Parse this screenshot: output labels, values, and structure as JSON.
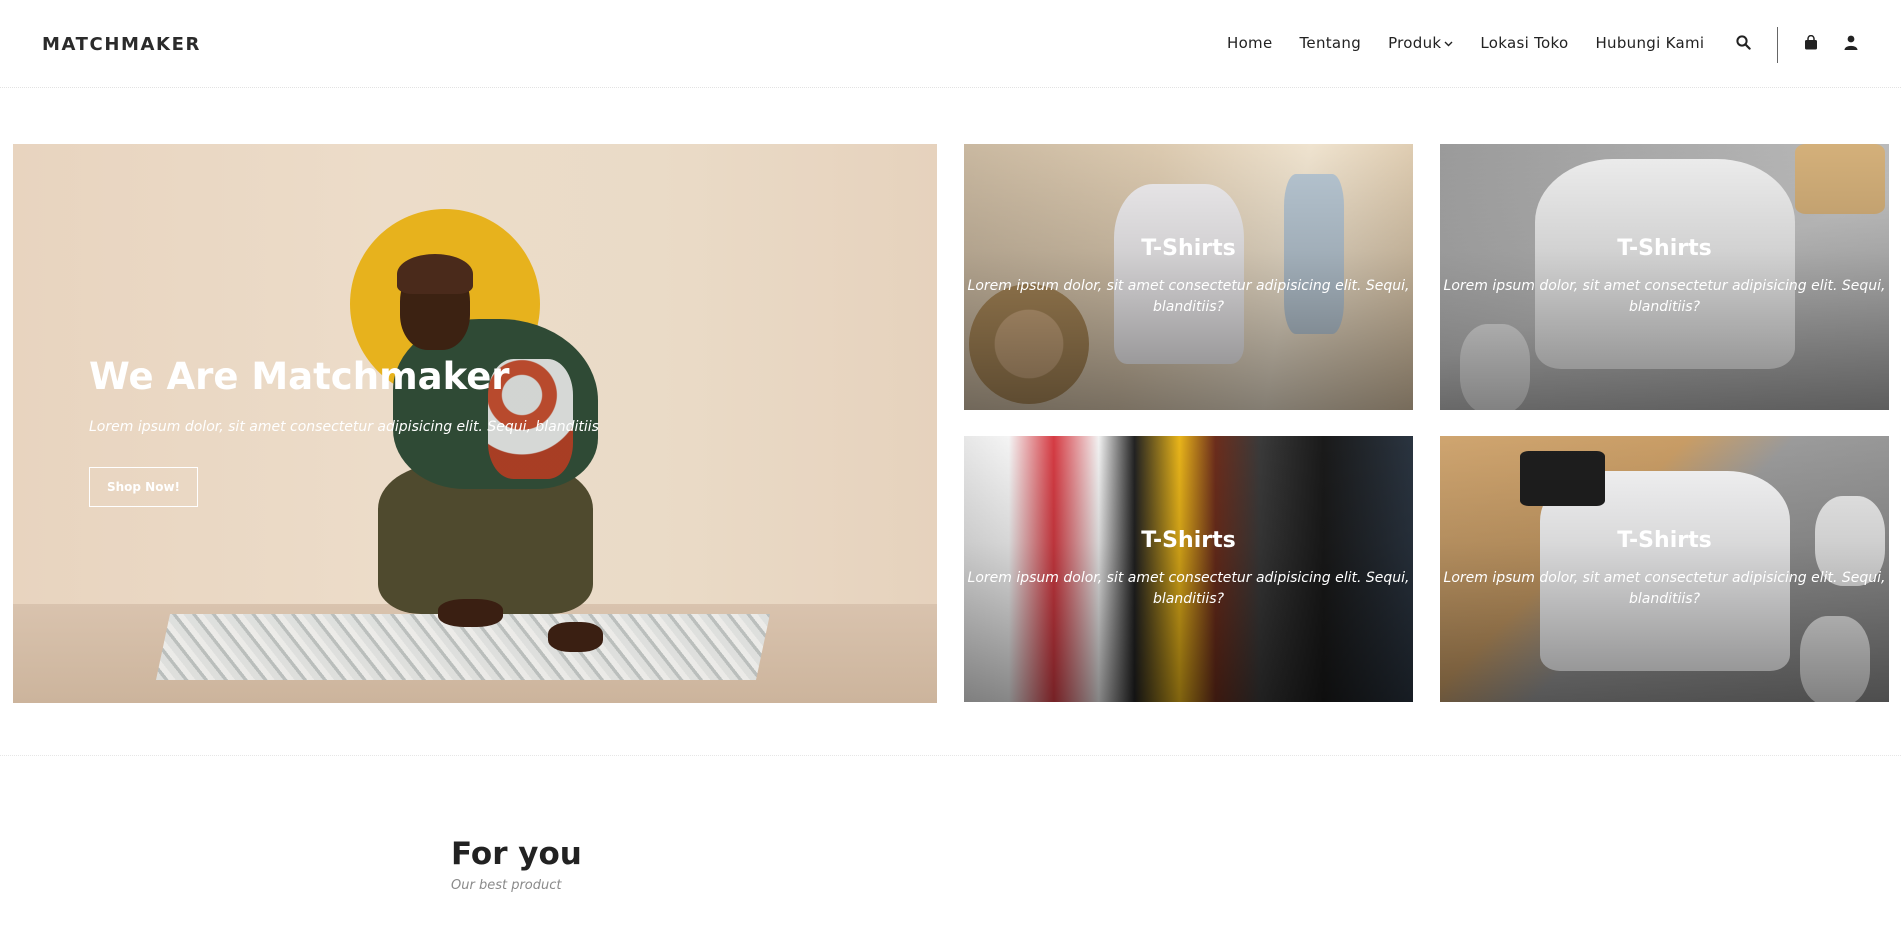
{
  "header": {
    "brand": "MATCHMAKER",
    "nav": {
      "home": "Home",
      "about": "Tentang",
      "products": "Produk",
      "store_location": "Lokasi Toko",
      "contact": "Hubungi Kami"
    },
    "icons": [
      "search-icon",
      "shopping-bag-icon",
      "user-icon"
    ]
  },
  "hero": {
    "title": "We Are Matchmaker",
    "subtitle": "Lorem ipsum dolor, sit amet consectetur adipisicing elit. Sequi, blanditiis",
    "button": "Shop Now!",
    "accent_color": "#e7b21d"
  },
  "cards": [
    {
      "title": "T-Shirts",
      "desc": "Lorem ipsum dolor, sit amet consectetur adipisicing elit. Sequi, blanditiis?"
    },
    {
      "title": "T-Shirts",
      "desc": "Lorem ipsum dolor, sit amet consectetur adipisicing elit. Sequi, blanditiis?"
    },
    {
      "title": "T-Shirts",
      "desc": "Lorem ipsum dolor, sit amet consectetur adipisicing elit. Sequi, blanditiis?"
    },
    {
      "title": "T-Shirts",
      "desc": "Lorem ipsum dolor, sit amet consectetur adipisicing elit. Sequi, blanditiis?"
    }
  ],
  "section": {
    "title": "For you",
    "subtitle": "Our best product"
  }
}
